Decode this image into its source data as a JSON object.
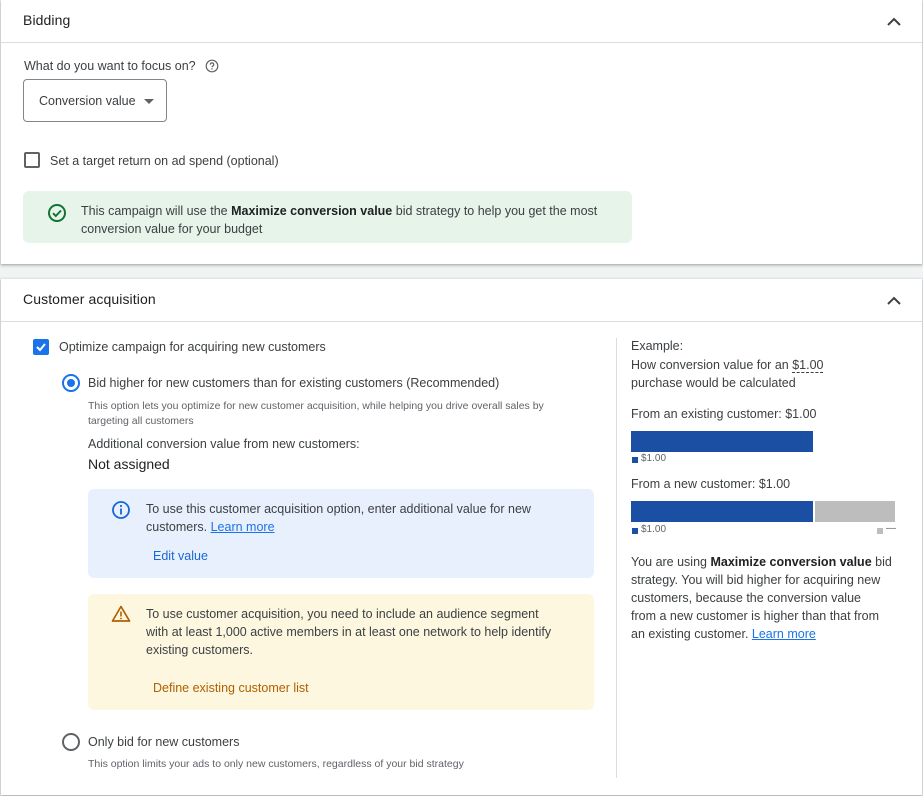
{
  "bidding": {
    "title": "Bidding",
    "focus_question": "What do you want to focus on?",
    "focus_value": "Conversion value",
    "target_roas_label": "Set a target return on ad spend (optional)",
    "notice_prefix": "This campaign will use the ",
    "notice_strategy": "Maximize conversion value",
    "notice_suffix": " bid strategy to help you get the most",
    "notice_line2": "conversion value for your budget"
  },
  "acquisition": {
    "title": "Customer acquisition",
    "optimize_label": "Optimize campaign for acquiring new customers",
    "option1_label": "Bid higher for new customers than for existing customers (Recommended)",
    "option1_desc_line1": "This option lets you optimize for new customer acquisition, while helping you drive overall sales by",
    "option1_desc_line2": "targeting all customers",
    "additional_label": "Additional conversion value from new customers:",
    "additional_value": "Not assigned",
    "info_line1": "To use this customer acquisition option, enter additional value for new",
    "info_line2": "customers. ",
    "info_learn_more": "Learn more",
    "edit_value": "Edit value",
    "warn_line1": "To use customer acquisition, you need to include an audience segment",
    "warn_line2": "with at least 1,000 active members in at least one network to help identify",
    "warn_line3": "existing customers.",
    "define_list": "Define existing customer list",
    "option2_label": "Only bid for new customers",
    "option2_desc": "This option limits your ads to only new customers, regardless of your bid strategy"
  },
  "example": {
    "heading": "Example:",
    "line1_prefix": "How conversion value for an ",
    "line1_amount": "$1.00",
    "line2": "purchase would be calculated",
    "existing_label": "From an existing customer: $1.00",
    "existing_legend": "$1.00",
    "new_label": "From a new customer: $1.00",
    "new_legend": "$1.00",
    "new_extra_legend": "—",
    "explain_1": "You are using ",
    "explain_strategy": "Maximize conversion value",
    "explain_2": " bid",
    "explain_line2": "strategy. You will bid higher for acquiring new",
    "explain_line3": "customers, because the conversion value",
    "explain_line4": "from a new customer is higher than that from",
    "explain_line5": "an existing customer. ",
    "explain_learn_more": "Learn more",
    "chart_values": {
      "existing_base": 1.0,
      "new_base": 1.0,
      "new_additional": 0.45,
      "max": 1.45
    },
    "colors": {
      "base": "#1a4fa3",
      "additional": "#bdbdbd"
    }
  }
}
